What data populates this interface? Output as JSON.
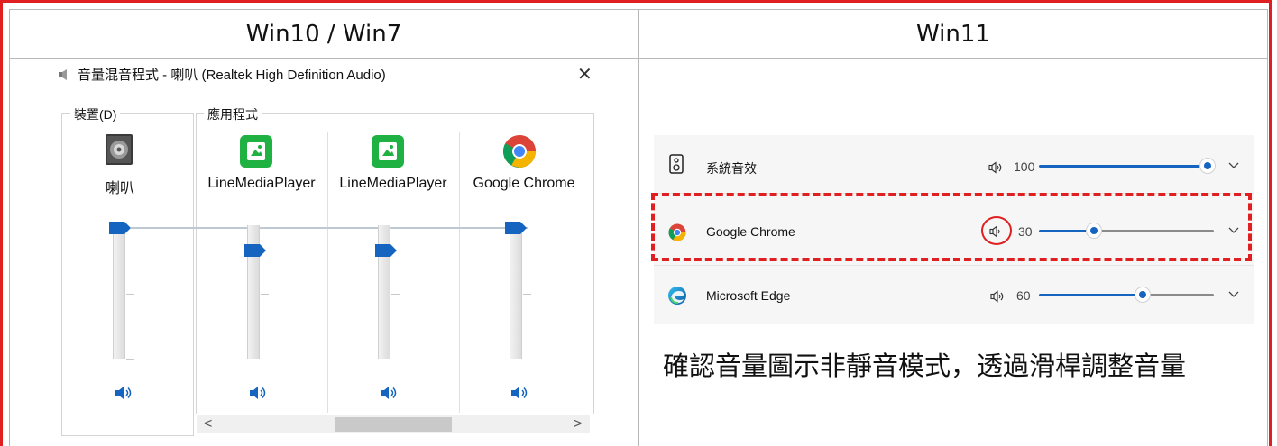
{
  "headers": {
    "left": "Win10 / Win7",
    "right": "Win11"
  },
  "mixer": {
    "title": "音量混音程式 - 喇叭 (Realtek High Definition Audio)",
    "device_group_label": "裝置(D)",
    "apps_group_label": "應用程式",
    "device": {
      "name": "喇叭",
      "level": 100
    },
    "apps": [
      {
        "name": "LineMediaPlayer",
        "level": 75
      },
      {
        "name": "LineMediaPlayer",
        "level": 75
      },
      {
        "name": "Google Chrome",
        "level": 100
      }
    ],
    "scroll_left": "<",
    "scroll_right": ">"
  },
  "win11": {
    "rows": [
      {
        "name": "系統音效",
        "value": "100",
        "level": 100
      },
      {
        "name": "Google Chrome",
        "value": "30",
        "level": 30
      },
      {
        "name": "Microsoft Edge",
        "value": "60",
        "level": 60
      }
    ],
    "caption": "確認音量圖示非靜音模式，透過滑桿調整音量"
  },
  "colors": {
    "accent": "#1565c0",
    "highlight": "#e02020",
    "line_green": "#1fb141"
  },
  "icons": [
    "speaker-device-icon",
    "line-app-icon",
    "chrome-icon",
    "edge-icon",
    "volume-icon",
    "chevron-down-icon",
    "close-icon"
  ]
}
